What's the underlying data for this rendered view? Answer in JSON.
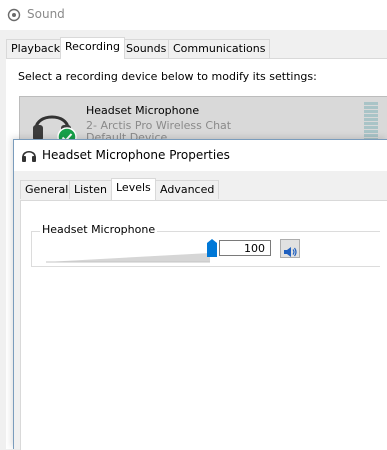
{
  "sound_window": {
    "title": "Sound",
    "tabs": [
      {
        "label": "Playback"
      },
      {
        "label": "Recording"
      },
      {
        "label": "Sounds"
      },
      {
        "label": "Communications"
      }
    ],
    "instruction": "Select a recording device below to modify its settings:",
    "device": {
      "name": "Headset Microphone",
      "description": "2- Arctis Pro Wireless Chat",
      "status": "Default Device"
    }
  },
  "properties_window": {
    "title": "Headset Microphone Properties",
    "tabs": [
      {
        "label": "General"
      },
      {
        "label": "Listen"
      },
      {
        "label": "Levels"
      },
      {
        "label": "Advanced"
      }
    ],
    "levels": {
      "group_label": "Headset Microphone",
      "volume_value": "100",
      "volume_level_percent": 100
    }
  },
  "colors": {
    "accent": "#0078d7",
    "selected_device_bg": "#d9d9d9",
    "check_green": "#16a04a"
  },
  "icons": {
    "sound_app": "speaker-app-icon",
    "headset": "headset-icon",
    "check": "checkmark-icon",
    "speaker_mute": "speaker-icon"
  }
}
